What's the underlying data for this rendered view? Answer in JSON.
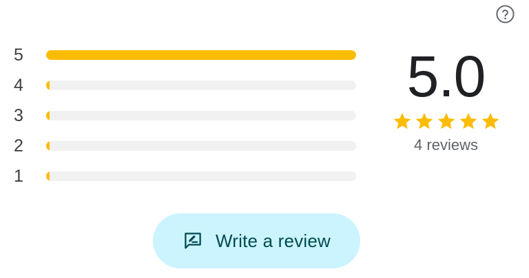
{
  "colors": {
    "bar_fill": "#fbbc04",
    "bar_track": "#f1f1f1",
    "star": "#fbbc04",
    "button_bg": "#cbf4ff",
    "button_text": "#004a4f"
  },
  "help": {
    "icon": "help-circle-icon"
  },
  "rating_distribution": [
    {
      "label": "5",
      "fraction": 1.0
    },
    {
      "label": "4",
      "fraction": 0.0
    },
    {
      "label": "3",
      "fraction": 0.0
    },
    {
      "label": "2",
      "fraction": 0.0
    },
    {
      "label": "1",
      "fraction": 0.0
    }
  ],
  "summary": {
    "average": "5.0",
    "stars_filled": 5,
    "stars_total": 5,
    "review_count_text": "4 reviews"
  },
  "write_review": {
    "label": "Write a review",
    "icon": "rate-review-icon"
  }
}
